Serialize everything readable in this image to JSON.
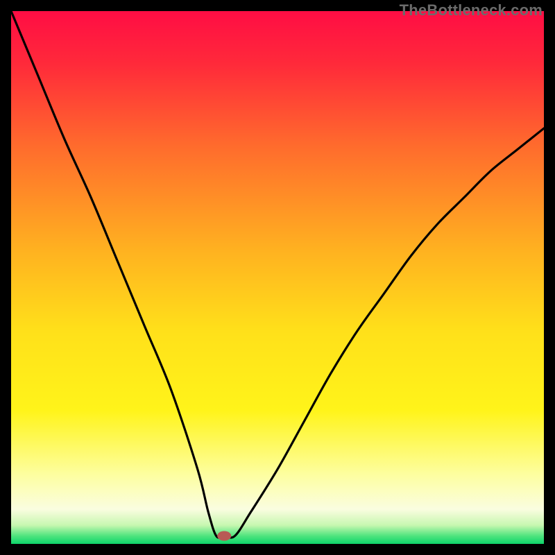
{
  "watermark": "TheBottleneck.com",
  "chart_data": {
    "type": "line",
    "title": "",
    "xlabel": "",
    "ylabel": "",
    "xlim": [
      0,
      100
    ],
    "ylim": [
      0,
      100
    ],
    "grid": false,
    "legend": false,
    "series": [
      {
        "name": "curve",
        "x": [
          0,
          5,
          10,
          15,
          20,
          25,
          30,
          35,
          37,
          38.5,
          40,
          42,
          45,
          50,
          55,
          60,
          65,
          70,
          75,
          80,
          85,
          90,
          95,
          100
        ],
        "y": [
          100,
          88,
          76,
          65,
          53,
          41,
          29,
          14,
          6,
          1.5,
          1.5,
          1.5,
          6,
          14,
          23,
          32,
          40,
          47,
          54,
          60,
          65,
          70,
          74,
          78
        ]
      }
    ],
    "marker": {
      "x": 40,
      "y": 1.5,
      "color": "#b85a55"
    },
    "gradient_stops": [
      {
        "offset": 0.0,
        "color": "#ff0d44"
      },
      {
        "offset": 0.1,
        "color": "#ff2a3a"
      },
      {
        "offset": 0.25,
        "color": "#ff6a2d"
      },
      {
        "offset": 0.45,
        "color": "#ffb220"
      },
      {
        "offset": 0.6,
        "color": "#ffe01a"
      },
      {
        "offset": 0.75,
        "color": "#fff41a"
      },
      {
        "offset": 0.87,
        "color": "#fdfea0"
      },
      {
        "offset": 0.935,
        "color": "#fafde0"
      },
      {
        "offset": 0.965,
        "color": "#c7f7b0"
      },
      {
        "offset": 0.985,
        "color": "#4fe47e"
      },
      {
        "offset": 1.0,
        "color": "#0dd46a"
      }
    ]
  }
}
